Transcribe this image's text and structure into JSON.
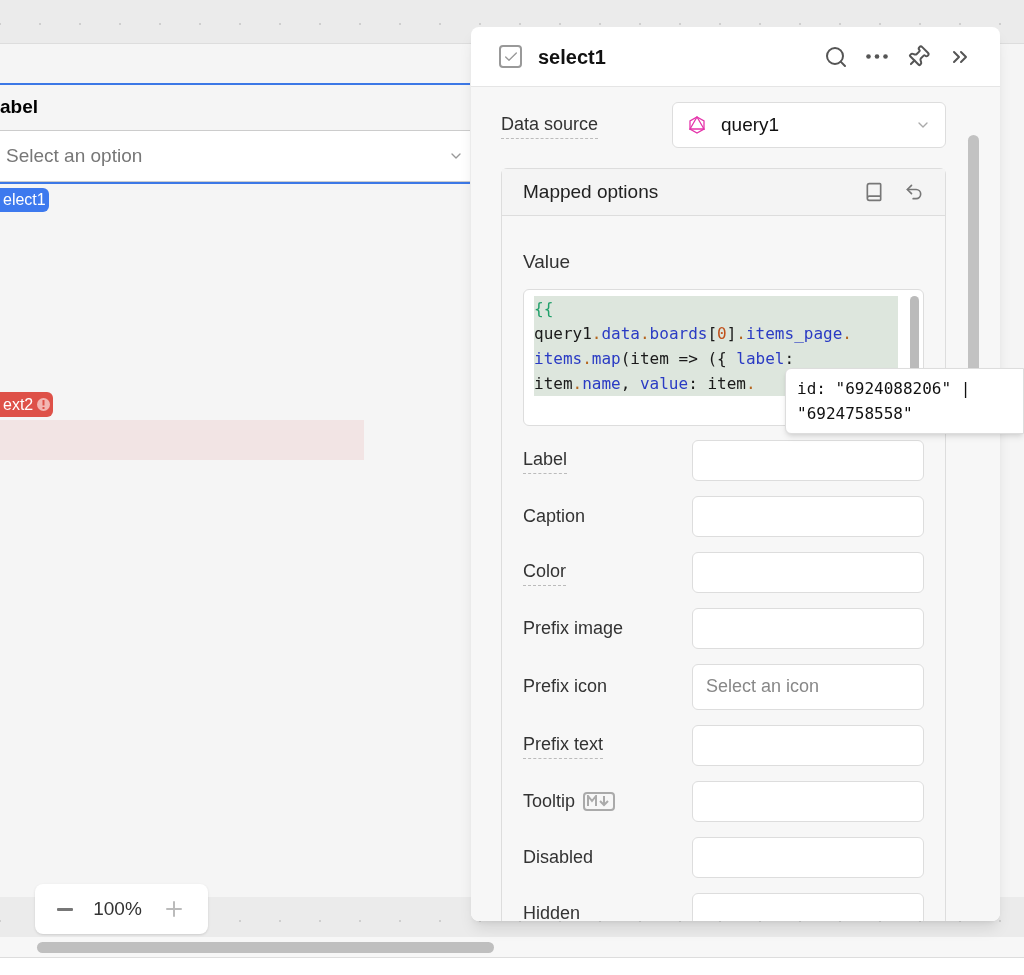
{
  "canvas": {
    "select_widget": {
      "label": "abel",
      "placeholder": "Select an option",
      "badge": "elect1",
      "selected": true
    },
    "text_widget": {
      "badge": "ext2",
      "error": true
    }
  },
  "zoom_control": {
    "value": "100%"
  },
  "inspector": {
    "title": "select1",
    "data_source": {
      "label": "Data source",
      "underlined": true,
      "value": "query1"
    },
    "mapped_options": {
      "title": "Mapped options",
      "value_label": "Value",
      "code": [
        [
          {
            "text": "{{",
            "kind": "brace"
          }
        ],
        [
          {
            "text": "query1",
            "kind": "plain"
          },
          {
            "text": ".",
            "kind": "dot"
          },
          {
            "text": "data",
            "kind": "prop"
          },
          {
            "text": ".",
            "kind": "dot"
          },
          {
            "text": "boards",
            "kind": "prop"
          },
          {
            "text": "[",
            "kind": "plain"
          },
          {
            "text": "0",
            "kind": "number"
          },
          {
            "text": "]",
            "kind": "plain"
          },
          {
            "text": ".",
            "kind": "dot"
          },
          {
            "text": "items_page",
            "kind": "prop"
          },
          {
            "text": ".",
            "kind": "dot"
          }
        ],
        [
          {
            "text": "items",
            "kind": "prop"
          },
          {
            "text": ".",
            "kind": "dot"
          },
          {
            "text": "map",
            "kind": "prop"
          },
          {
            "text": "(item => ({ ",
            "kind": "plain"
          },
          {
            "text": "label",
            "kind": "prop"
          },
          {
            "text": ":",
            "kind": "plain"
          }
        ],
        [
          {
            "text": "item",
            "kind": "plain"
          },
          {
            "text": ".",
            "kind": "dot"
          },
          {
            "text": "name",
            "kind": "prop"
          },
          {
            "text": ", ",
            "kind": "plain"
          },
          {
            "text": "value",
            "kind": "prop"
          },
          {
            "text": ": item",
            "kind": "plain"
          },
          {
            "text": ".",
            "kind": "dot"
          }
        ]
      ],
      "tooltip": "id: \"6924088206\" | \"6924758558\""
    },
    "fields": [
      {
        "label": "Label",
        "underlined": true
      },
      {
        "label": "Caption",
        "underlined": false
      },
      {
        "label": "Color",
        "underlined": true
      },
      {
        "label": "Prefix image",
        "underlined": false
      },
      {
        "label": "Prefix icon",
        "underlined": false,
        "placeholder": "Select an icon"
      },
      {
        "label": "Prefix text",
        "underlined": true
      },
      {
        "label": "Tooltip",
        "underlined": false,
        "markdown": true
      },
      {
        "label": "Disabled",
        "underlined": false
      },
      {
        "label": "Hidden",
        "underlined": false
      }
    ]
  }
}
